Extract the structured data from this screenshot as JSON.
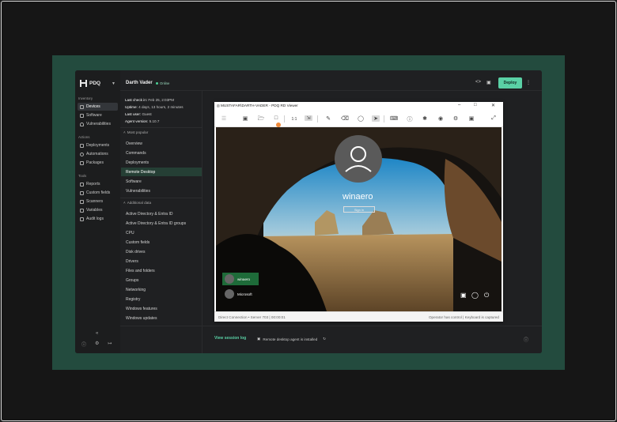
{
  "app": {
    "brand": "PDQ",
    "sidebar": {
      "sections": [
        {
          "label": "Inventory",
          "items": [
            {
              "label": "Devices",
              "icon": "desktop-icon",
              "active": true
            },
            {
              "label": "Software",
              "icon": "box-icon"
            },
            {
              "label": "Vulnerabilities",
              "icon": "shield-icon"
            }
          ]
        },
        {
          "label": "Actions",
          "items": [
            {
              "label": "Deployments",
              "icon": "rocket-icon"
            },
            {
              "label": "Automations",
              "icon": "gear-icon"
            },
            {
              "label": "Packages",
              "icon": "package-icon"
            }
          ]
        },
        {
          "label": "Tools",
          "items": [
            {
              "label": "Reports",
              "icon": "chart-icon"
            },
            {
              "label": "Custom fields",
              "icon": "list-icon"
            },
            {
              "label": "Scanners",
              "icon": "scan-icon"
            },
            {
              "label": "Variables",
              "icon": "variable-icon"
            },
            {
              "label": "Audit logs",
              "icon": "log-icon"
            }
          ]
        }
      ]
    },
    "device": {
      "name": "Darth Vader",
      "status": "Online",
      "status_color": "#4ccf95",
      "last_checkin_label": "Last check in:",
      "last_checkin": "Feb 25, 2:03PM",
      "uptime_label": "Uptime:",
      "uptime": "4 days, 13 hours, 2 minutes",
      "last_user_label": "Last user:",
      "last_user": "Guest",
      "agent_label": "Agent version:",
      "agent_version": "5.10.7"
    },
    "toolbar": {
      "deploy_label": "Deploy",
      "accent": "#5ad0a5"
    },
    "panel": {
      "most_popular_label": "Most popular",
      "most_popular": [
        "Overview",
        "Commands",
        "Deployments",
        "Remote Desktop",
        "Software",
        "Vulnerabilities"
      ],
      "active_item": "Remote Desktop",
      "additional_label": "Additional data",
      "additional": [
        "Active Directory & Entra ID",
        "Active Directory & Entra ID groups",
        "CPU",
        "Custom fields",
        "Disk drives",
        "Drivers",
        "Files and folders",
        "Groups",
        "Networking",
        "Registry",
        "Windows features",
        "Windows updates"
      ]
    },
    "viewer": {
      "title": "MUSTAFAR\\DARTH-VADER - PDQ RD Viewer",
      "zoom_label": "1:1",
      "lock_user": "winaero",
      "sign_in": "Sign in",
      "users": [
        {
          "name": "winaero",
          "active": true
        },
        {
          "name": "Microsoft",
          "active": false
        }
      ],
      "status_left": "Direct Connection • Server 703 | 00:00:01",
      "status_right": "Operator has control | Keyboard is captured"
    },
    "footer": {
      "session_link": "View session log",
      "agent_status": "Remote desktop agent is installed"
    }
  }
}
